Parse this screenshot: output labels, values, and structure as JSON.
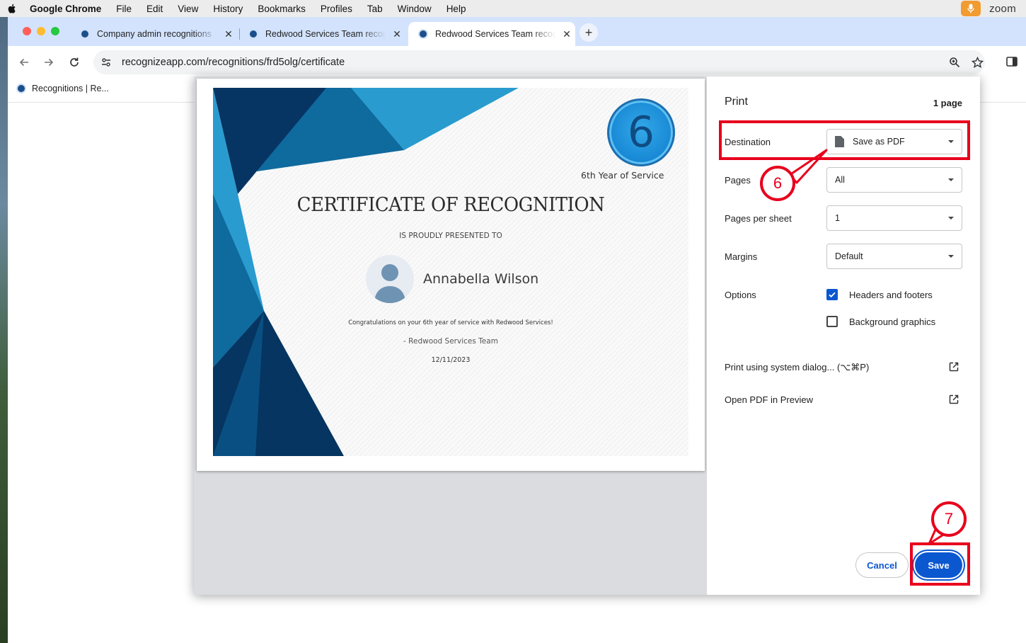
{
  "menubar": {
    "app_name": "Google Chrome",
    "items": [
      "File",
      "Edit",
      "View",
      "History",
      "Bookmarks",
      "Profiles",
      "Tab",
      "Window",
      "Help"
    ],
    "zoom_label": "zoom"
  },
  "tabs": [
    {
      "title": "Company admin recognitions",
      "active": false
    },
    {
      "title": "Redwood Services Team recognition",
      "active": false
    },
    {
      "title": "Redwood Services Team recognition",
      "active": true
    }
  ],
  "toolbar": {
    "url": "recognizeapp.com/recognitions/frd5olg/certificate"
  },
  "bookmarks": [
    {
      "label": "Recognitions | Re..."
    }
  ],
  "certificate": {
    "badge_number": "6",
    "year_of_service": "6th Year of Service",
    "title": "CERTIFICATE OF RECOGNITION",
    "subtitle": "IS PROUDLY PRESENTED TO",
    "recipient": "Annabella Wilson",
    "message": "Congratulations on your 6th year of service with Redwood Services!",
    "signature": "- Redwood Services Team",
    "date": "12/11/2023"
  },
  "print": {
    "title": "Print",
    "page_count": "1 page",
    "destination_label": "Destination",
    "destination_value": "Save as PDF",
    "pages_label": "Pages",
    "pages_value": "All",
    "pps_label": "Pages per sheet",
    "pps_value": "1",
    "margins_label": "Margins",
    "margins_value": "Default",
    "options_label": "Options",
    "opt_headers": "Headers and footers",
    "opt_headers_checked": true,
    "opt_background": "Background graphics",
    "opt_background_checked": false,
    "system_dialog": "Print using system dialog... (⌥⌘P)",
    "open_pdf": "Open PDF in Preview",
    "cancel": "Cancel",
    "save": "Save"
  },
  "annotations": {
    "step_destination": "6",
    "step_save": "7",
    "color": "#e8001c"
  }
}
